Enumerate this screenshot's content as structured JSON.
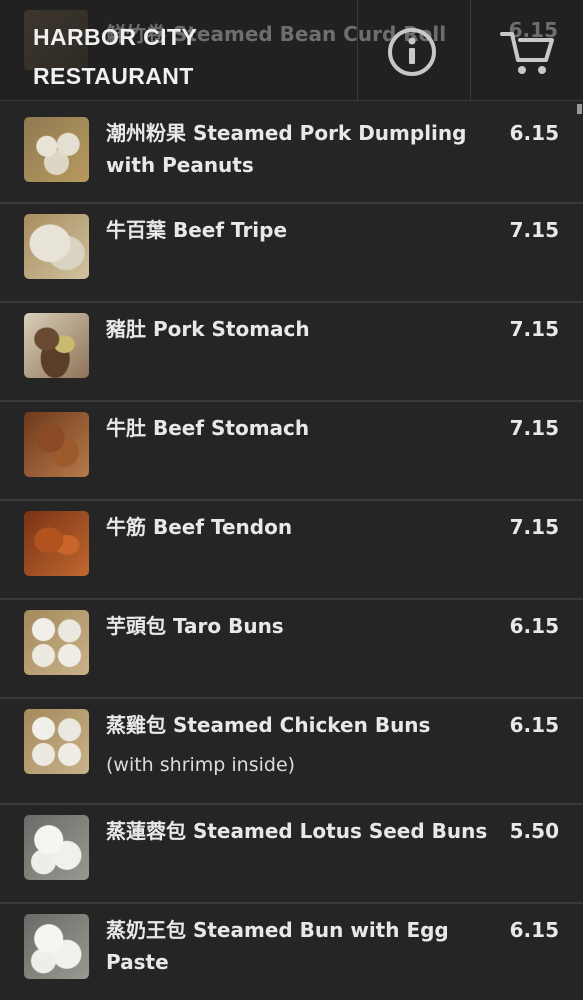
{
  "header": {
    "brand": "HARBOR CITY RESTAURANT",
    "brand_line1": "HARBOR CITY",
    "brand_line2": "RESTAURANT",
    "peek_item_name": "鮮竹卷 Steamed Bean Curd Roll",
    "peek_item_price": "6.15",
    "info_icon": "info-circle-icon",
    "cart_icon": "shopping-cart-icon"
  },
  "colors": {
    "background": "#252525",
    "header_bg": "#212121",
    "divider": "#3a3a3a",
    "text": "#e8e8e8"
  },
  "items": [
    {
      "name": "潮州粉果 Steamed Pork Dumpling with Peanuts",
      "price": "6.15",
      "description": "",
      "thumb": "dumpling"
    },
    {
      "name": "牛百葉 Beef Tripe",
      "price": "7.15",
      "description": "",
      "thumb": "tripe"
    },
    {
      "name": "豬肚 Pork Stomach",
      "price": "7.15",
      "description": "",
      "thumb": "stomach"
    },
    {
      "name": "牛肚 Beef Stomach",
      "price": "7.15",
      "description": "",
      "thumb": "beef-stomach"
    },
    {
      "name": "牛筋 Beef Tendon",
      "price": "7.15",
      "description": "",
      "thumb": "tendon"
    },
    {
      "name": "芋頭包 Taro Buns",
      "price": "6.15",
      "description": "",
      "thumb": "buns"
    },
    {
      "name": "蒸雞包 Steamed Chicken Buns",
      "price": "6.15",
      "description": "(with shrimp inside)",
      "thumb": "buns"
    },
    {
      "name": "蒸蓮蓉包 Steamed Lotus Seed Buns",
      "price": "5.50",
      "description": "",
      "thumb": "buns-white"
    },
    {
      "name": "蒸奶王包 Steamed Bun with Egg Paste",
      "price": "6.15",
      "description": "",
      "thumb": "buns-white"
    }
  ]
}
